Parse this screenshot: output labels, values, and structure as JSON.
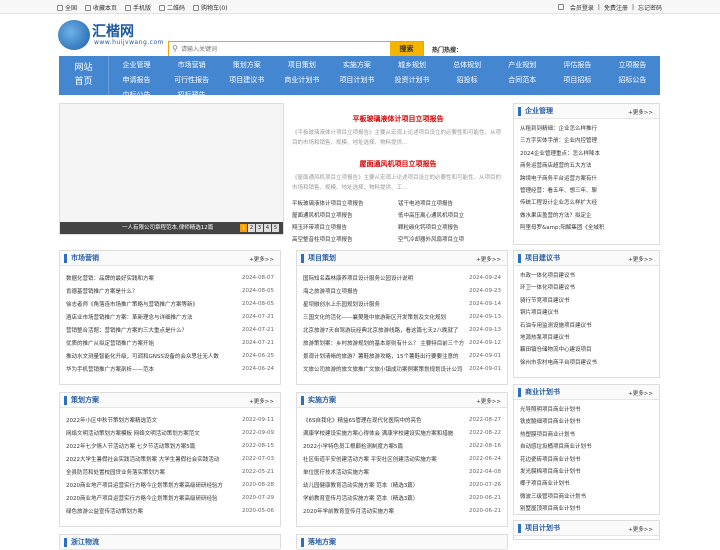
{
  "topbar": {
    "links": [
      "全国",
      "收藏本页",
      "手机版",
      "二维码",
      "购物车(0)"
    ],
    "right": [
      "会员登录",
      "免费注册",
      "忘记密码"
    ]
  },
  "logo": {
    "name": "汇楷网",
    "url": "www.huijvwang.com"
  },
  "search": {
    "placeholder": "请输入关键词",
    "button": "搜索",
    "hot_label": "热门热搜："
  },
  "nav": {
    "home": [
      "网站",
      "首页"
    ],
    "items": [
      "企业管理",
      "市场营销",
      "策划方案",
      "项目策划",
      "实施方案",
      "城乡规划",
      "总体规划",
      "产业规划",
      "评估报告",
      "立项报告",
      "申请报告",
      "可行性报告",
      "项目建议书",
      "商业计划书",
      "项目计划书",
      "投资计划书",
      "招投标",
      "合同范本",
      "项目招标",
      "招标公告",
      "中标公告",
      "招标预告"
    ]
  },
  "banner": {
    "caption": "一人有限公司章程范本,律师精选12篇",
    "pages": [
      "1",
      "2",
      "3",
      "4",
      "5"
    ]
  },
  "news": {
    "items": [
      {
        "title": "平板玻璃液体计项目立项报告",
        "desc": "《平板玻璃液体计项目立项报告》主要从宏观上论述项目设立的必要性和可能性，从项目的市场和销售、规模、地址选择、物料提供..."
      },
      {
        "title": "屋面通风机项目立项报告",
        "desc": "《屋面通风机项目立项报告》主要从宏观上论述项目设立的必要性和可能性，从项目的市场和销售、规模、地址选择、物料提供、工..."
      }
    ],
    "list": [
      "平板玻璃液体计项目立项报告",
      "锰干电池项目立项报告",
      "屋面通风机项目立项报告",
      "低中高压离心通风机项目立",
      "翔玉环带项目立项报告",
      "颗粒碳化钙项目立项报告",
      "高空整音柱项目立项报告",
      "空气冷却器外风扇项目立项"
    ]
  },
  "sections": {
    "market": {
      "title": "市场营销",
      "more": "+更多>>",
      "rows": [
        [
          "数据化营销：品牌的最好实践和方案",
          "2024-08-07"
        ],
        [
          "肯德基营销推广方案是什么？",
          "2024-08-05"
        ],
        [
          "徐志者师《角落连市场推广策略与营销推广方案等新》",
          "2024-08-05"
        ],
        [
          "酒店业市场营销推广方案：革新理念与详细推广方法",
          "2024-07-21"
        ],
        [
          "营销整合活题：营销推广方案的三大重点是什么？",
          "2024-07-21"
        ],
        [
          "优质的推广从拟定营销推广方案开始",
          "2024-07-21"
        ],
        [
          "推动水文测量智能化升级，可调和GNSS设备的会众思壮无人数",
          "2024-06-25"
        ],
        [
          "华为手机营销推广方案剖析——范本",
          "2024-06-24"
        ]
      ]
    },
    "project": {
      "title": "项目策划",
      "more": "+更多>>",
      "rows": [
        [
          "国际知名森林康养项目设计服务公园设计说明",
          "2024-09-24"
        ],
        [
          "海之旅游项目立项报告",
          "2024-09-23"
        ],
        [
          "星坝融创水上乐园规划设计服务",
          "2024-09-14"
        ],
        [
          "三国文化的活化——襄樊隆中旅游新区开发策划及文化规划",
          "2024-09-13"
        ],
        [
          "北京旅游7天自驾游玩经典北京旅游线路，看这篇七天2八晚就了",
          "2024-09-13"
        ],
        [
          "旅游策划案：乡村旅游规划的基本原则有什么？ 主要特目前三个方",
          "2024-09-12"
        ],
        [
          "景观计划清晰的旅游？薯鞋旅游攻略，15个薯鞋出行要要注意的",
          "2024-09-01"
        ],
        [
          "文旅公司旅游的旅文旅推广文旅小镇成功案例案策划规划设计公司",
          "2024-09-01"
        ]
      ]
    },
    "plan": {
      "title": "策划方案",
      "more": "+更多>>",
      "rows": [
        [
          "2022年小区中秋节策划方案精选范文",
          "2022-09-11"
        ],
        [
          "网络文明活动策划方案模板 网络文明活动策划方案范文",
          "2022-09-09"
        ],
        [
          "2022年七夕情人节活动方案 七夕节活动策划方案5篇",
          "2022-08-15"
        ],
        [
          "2022大学生暑假社会实践活动策划案 大学生暑假社会实践活动",
          "2022-07-03"
        ],
        [
          "全县防范和处置校园贷业务落实策划方案",
          "2022-05-21"
        ],
        [
          "2020商业地产项目运营实行方略今企划策划方案高级研研经验方",
          "2020-08-28"
        ],
        [
          "2020商业地产项目运营实行方略今企划策划方案高级研研经验",
          "2020-07-29"
        ],
        [
          "绿色旅游公益宣传活动策划方案",
          "2020-05-06"
        ]
      ]
    },
    "implement": {
      "title": "实施方案",
      "more": "+更多>>",
      "rows": [
        [
          "《6S自我化》精益6S管理在现代化医院中的亮色",
          "2022-08-27"
        ],
        [
          "满康学校建设实施方案心得体会 满康学校建设实施方案和措施",
          "2022-08-22"
        ],
        [
          "2022小学特色员工根颠检测制度方案5篇",
          "2022-08-16"
        ],
        [
          "社区街道平安创建活动方案 平安社区创建活动实施方案",
          "2022-06-24"
        ],
        [
          "单位医疗技术活动实施方案",
          "2022-04-08"
        ],
        [
          "幼儿园健康教育活动实施方案 范本（精选3篇）",
          "2020-07-26"
        ],
        [
          "学前教育宣传月活动实施方案 范本（精选3篇）",
          "2020-06-21"
        ],
        [
          "2020年学前教育宣传月活动实施方案",
          "2020-06-21"
        ]
      ]
    }
  },
  "sidebar": {
    "mgmt": {
      "title": "企业管理",
      "more": "+更多>>",
      "items": [
        "从租到到精细：企业怎么样推行",
        "三方字实体手册：企业内控管理",
        "2024企业管理重点：怎么样降本",
        "商务运营商店超营的五大方法",
        "跨境电子商务平台运营方案有什",
        "管理经营：看五年、想三年、聊",
        "传统工程设计企业怎么样扩大经",
        "做水果店盈营的方法？拟定企",
        "阿里母罗&amp;阳解集团《全域积"
      ]
    },
    "proposal": {
      "title": "项目建议书",
      "more": "+更多>>",
      "items": [
        "市政一体化项目建议书",
        "环卫一体化项目建议书",
        "骑行节竞项目建议书",
        "铜片项目建议书",
        "石油专用监测设施项目建议书",
        "地源热泵项目建议书",
        "藕田镇仓储物流中心建设项目",
        "徐州市农村电商平台项目建议书"
      ]
    },
    "biz": {
      "title": "商业计划书",
      "more": "+更多>>",
      "items": [
        "光导照明项目商业计划书",
        "铁皮髓细项目商业计划书",
        "热塑膜项目商业计划书",
        "自动感垃圾桶项目商业计划书",
        "花边瓷砖项目商业计划书",
        "发光膜棉项目商业计划书",
        "椰子项目商业计划书",
        "微波三级管项目商业计划书",
        "别墅屋顶项目商业计划书"
      ]
    },
    "plan2": {
      "title": "项目计划书",
      "more": "+更多>>"
    }
  },
  "bottom": {
    "left": "浙江物流",
    "right": "落地方案"
  }
}
